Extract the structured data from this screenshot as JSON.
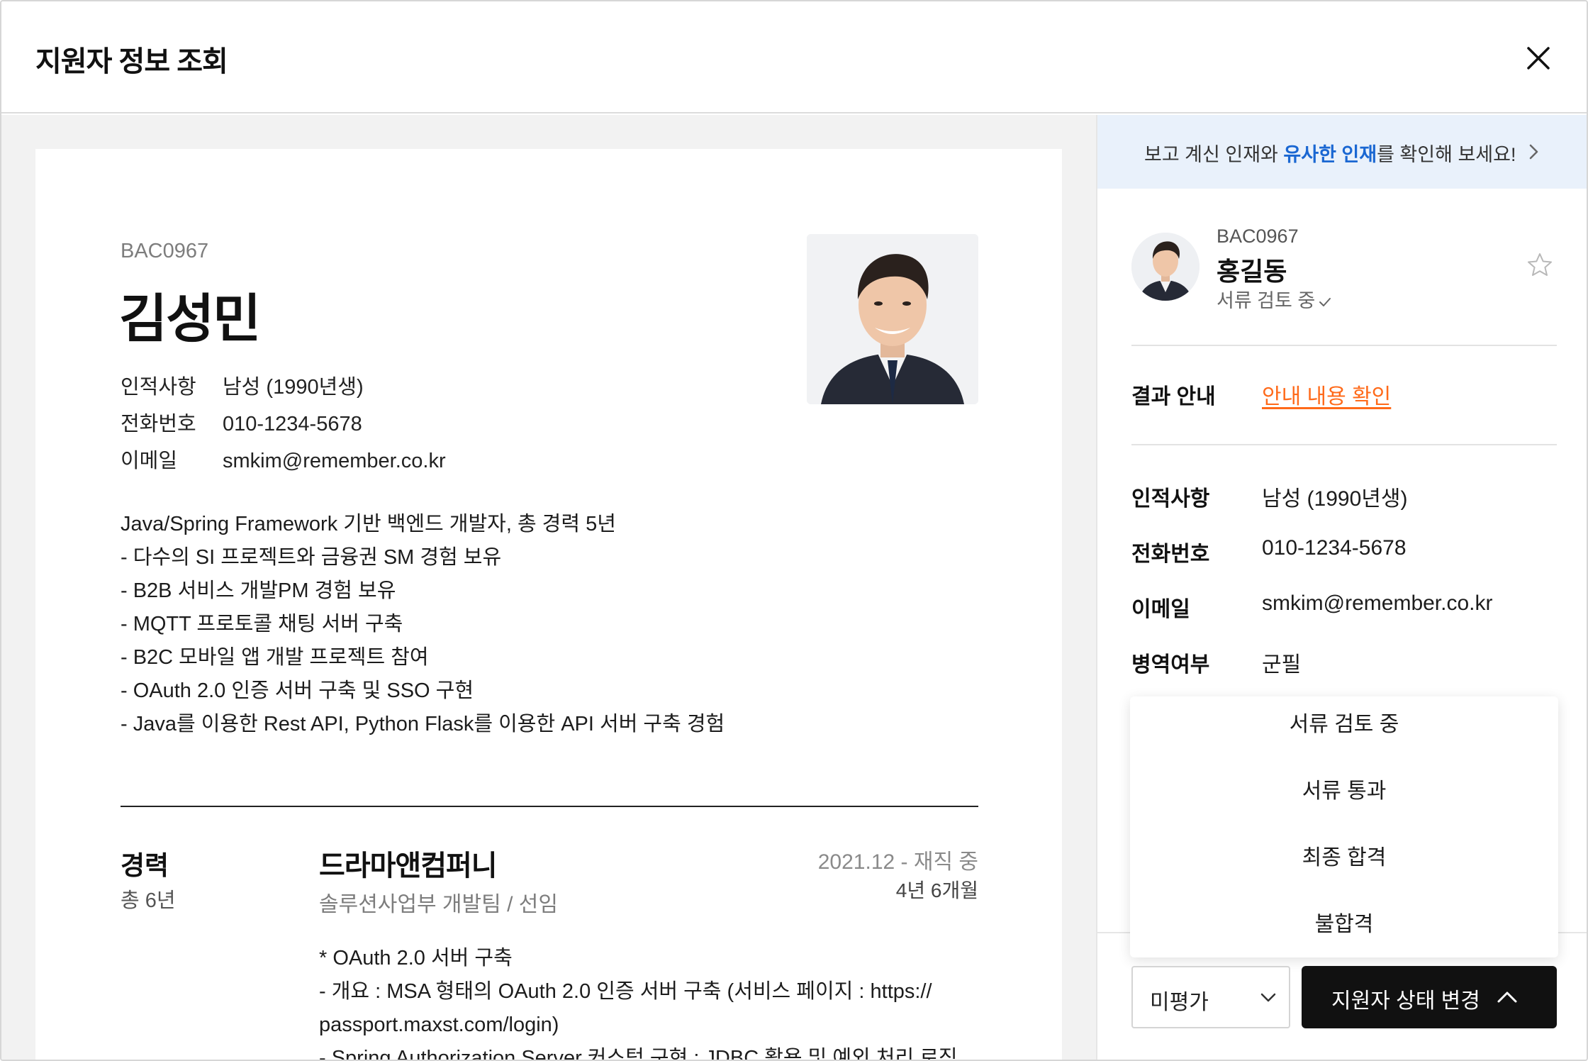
{
  "header": {
    "title": "지원자 정보 조회"
  },
  "resume": {
    "code": "BAC0967",
    "name": "김성민",
    "info": [
      {
        "label": "인적사항",
        "value": "남성 (1990년생)"
      },
      {
        "label": "전화번호",
        "value": "010-1234-5678"
      },
      {
        "label": "이메일",
        "value": "smkim@remember.co.kr"
      }
    ],
    "summary": [
      "Java/Spring Framework 기반 백엔드 개발자, 총 경력 5년",
      "- 다수의 SI 프로젝트와 금융권 SM 경험 보유",
      "- B2B 서비스 개발PM 경험 보유",
      "- MQTT 프로토콜 채팅 서버 구축",
      "- B2C 모바일 앱 개발 프로젝트 참여",
      "- OAuth 2.0 인증 서버 구축 및 SSO 구현",
      "- Java를 이용한 Rest API, Python Flask를 이용한 API 서버 구축 경험"
    ],
    "career": {
      "title": "경력",
      "total": "총 6년",
      "company": "드라마앤컴퍼니",
      "dept": "솔루션사업부 개발팀 / 선임",
      "period": "2021.12 - 재직 중",
      "duration": "4년 6개월",
      "desc": [
        "* OAuth 2.0 서버 구축",
        "- 개요 : MSA 형태의 OAuth 2.0 인증 서버 구축 (서비스 페이지 : https://",
        "passport.maxst.com/login)",
        "- Spring Authorization Server 커스텀 구현 : JDBC 활용 및 예외 처리 로직"
      ]
    }
  },
  "panel": {
    "banner": {
      "prefix": "보고 계신 인재와 ",
      "highlight": "유사한 인재",
      "suffix": "를 확인해 보세요!"
    },
    "profile": {
      "code": "BAC0967",
      "name": "홍길동",
      "status": "서류 검토 중"
    },
    "result": {
      "label": "결과 안내",
      "link": "안내 내용 확인"
    },
    "fields": [
      {
        "label": "인적사항",
        "value": "남성 (1990년생)"
      },
      {
        "label": "전화번호",
        "value": "010-1234-5678"
      },
      {
        "label": "이메일",
        "value": "smkim@remember.co.kr"
      },
      {
        "label": "병역여부",
        "value": "군필"
      }
    ],
    "status_menu": [
      "서류 검토 중",
      "서류 통과",
      "최종 합격",
      "불합격"
    ],
    "eval_select": "미평가",
    "change_button": "지원자 상태 변경"
  },
  "colors": {
    "accent_blue": "#1a67d2",
    "link_orange": "#ff6a1a",
    "banner_bg": "#e9f1fb",
    "button_dark": "#111111"
  }
}
